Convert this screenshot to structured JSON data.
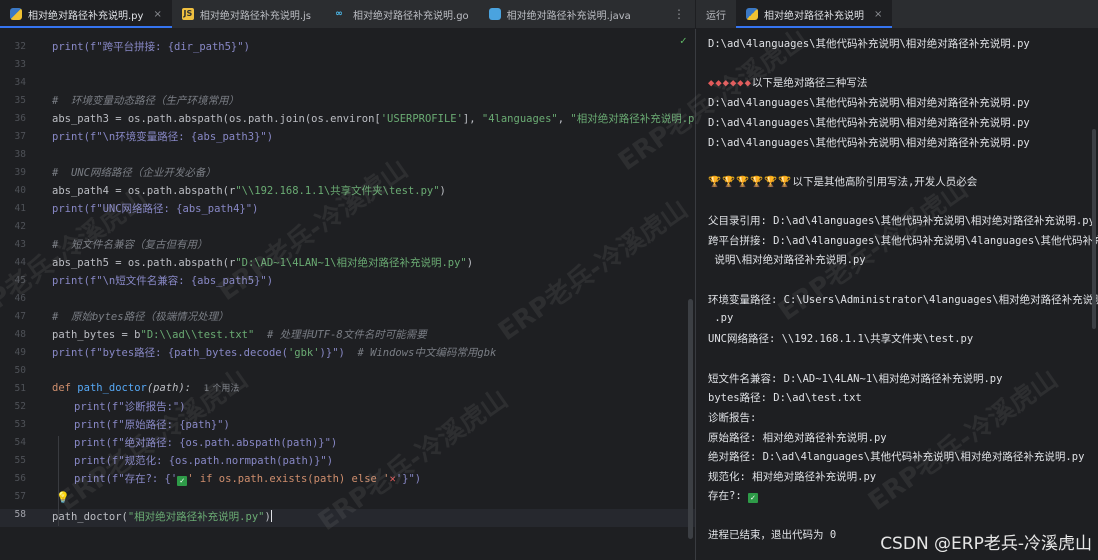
{
  "editor_tabs": [
    {
      "label": "相对绝对路径补充说明.py",
      "icon": "python-file-icon",
      "active": true
    },
    {
      "label": "相对绝对路径补充说明.js",
      "icon": "javascript-file-icon",
      "active": false
    },
    {
      "label": "相对绝对路径补充说明.go",
      "icon": "go-file-icon",
      "active": false
    },
    {
      "label": "相对绝对路径补充说明.java",
      "icon": "java-file-icon",
      "active": false
    }
  ],
  "run_panel": {
    "run_label": "运行",
    "tab_label": "相对绝对路径补充说明",
    "close_glyph": "×"
  },
  "line_numbers": [
    "32",
    "33",
    "34",
    "35",
    "36",
    "37",
    "38",
    "39",
    "40",
    "41",
    "42",
    "43",
    "44",
    "45",
    "46",
    "47",
    "48",
    "49",
    "50",
    "51",
    "52",
    "53",
    "54",
    "55",
    "56",
    "57",
    "58"
  ],
  "code": {
    "l32": "print(f\"跨平台拼接: {dir_path5}\")",
    "c35": "#  环境变量动态路径（生产环境常用）",
    "l36a": "abs_path3 = os.path.abspath(os.path.join(os.environ[",
    "l36b": "'USERPROFILE'",
    "l36c": "], ",
    "l36d": "\"4languages\"",
    "l36e": ", ",
    "l36f": "\"相对绝对路径补充说明.py\"",
    "l36g": "))",
    "l37": "print(f\"\\n环境变量路径: {abs_path3}\")",
    "c39": "#  UNC网络路径（企业开发必备）",
    "l40a": "abs_path4 = os.path.abspath(r",
    "l40b": "\"\\\\192.168.1.1\\共享文件夹\\test.py\"",
    "l40c": ")",
    "l41": "print(f\"UNC网络路径: {abs_path4}\")",
    "c43": "#  短文件名兼容（复古但有用）",
    "l44a": "abs_path5 = os.path.abspath(r",
    "l44b": "\"D:\\AD~1\\4LAN~1\\相对绝对路径补充说明.py\"",
    "l44c": ")",
    "l45": "print(f\"\\n短文件名兼容: {abs_path5}\")",
    "c47": "#  原始bytes路径（极端情况处理）",
    "l48a": "path_bytes = b",
    "l48b": "\"D:\\\\ad\\\\test.txt\"",
    "l48c": "  # 处理非UTF-8文件名时可能需要",
    "l49a": "print(f\"bytes路径: {path_bytes.decode(",
    "l49b": "'gbk'",
    "l49c": ")}\")",
    "l49d": "  # Windows中文编码常用gbk",
    "l51a": "def ",
    "l51b": "path_doctor",
    "l51c": "(path):",
    "l51hint": "1 个用法",
    "l52": "print(f\"诊断报告:\")",
    "l53": "print(f\"原始路径: {path}\")",
    "l54": "print(f\"绝对路径: {os.path.abspath(path)}\")",
    "l55": "print(f\"规范化: {os.path.normpath(path)}\")",
    "l56a": "print(f\"存在?: {'",
    "l56b": "✓",
    "l56c": "' if os.path.exists(path) else '",
    "l56d": "✕",
    "l56e": "'}\")",
    "l58a": "path_doctor(",
    "l58b": "\"相对绝对路径补充说明.py\"",
    "l58c": ")"
  },
  "console": {
    "o1": "D:\\ad\\4languages\\其他代码补充说明\\相对绝对路径补充说明.py",
    "o2_emoji": "◆◆◆◆◆◆",
    "o2_text": "以下是绝对路径三种写法",
    "o3": "D:\\ad\\4languages\\其他代码补充说明\\相对绝对路径补充说明.py",
    "o4": "D:\\ad\\4languages\\其他代码补充说明\\相对绝对路径补充说明.py",
    "o5": "D:\\ad\\4languages\\其他代码补充说明\\相对绝对路径补充说明.py",
    "o6_emoji": "🏆🏆🏆🏆🏆🏆",
    "o6_text": "以下是其他高阶引用写法,开发人员必会",
    "o7": "父目录引用: D:\\ad\\4languages\\其他代码补充说明\\相对绝对路径补充说明.py",
    "o8": "跨平台拼接: D:\\ad\\4languages\\其他代码补充说明\\4languages\\其他代码补充",
    "o8b": " 说明\\相对绝对路径补充说明.py",
    "o9": "环境变量路径: C:\\Users\\Administrator\\4languages\\相对绝对路径补充说明",
    "o9b": " .py",
    "o10": "UNC网络路径: \\\\192.168.1.1\\共享文件夹\\test.py",
    "o11": "短文件名兼容: D:\\AD~1\\4LAN~1\\相对绝对路径补充说明.py",
    "o12": "bytes路径: D:\\ad\\test.txt",
    "o13": "诊断报告:",
    "o14": "原始路径: 相对绝对路径补充说明.py",
    "o15": "绝对路径: D:\\ad\\4languages\\其他代码补充说明\\相对绝对路径补充说明.py",
    "o16": "规范化: 相对绝对路径补充说明.py",
    "o17": "存在?: ",
    "o17_check": "✓",
    "o18": "进程已结束，退出代码为 0"
  },
  "watermark": "ERP老兵-冷溪虎山",
  "credit": "CSDN @ERP老兵-冷溪虎山"
}
